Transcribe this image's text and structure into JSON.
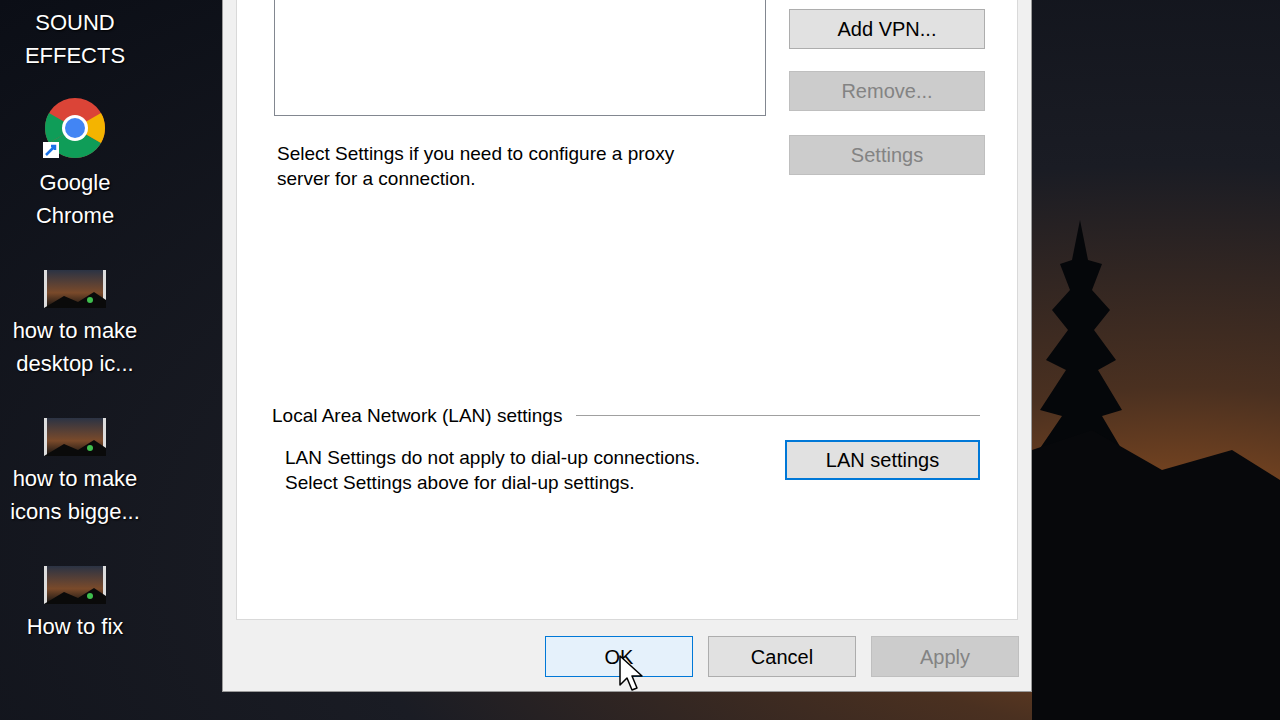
{
  "desktop_icons": [
    {
      "label": "SOUND EFFECTS",
      "kind": "folder"
    },
    {
      "label": "Google Chrome",
      "kind": "chrome"
    },
    {
      "label": "how to make desktop ic...",
      "kind": "video"
    },
    {
      "label": "how to make icons bigge...",
      "kind": "video"
    },
    {
      "label": "How to fix",
      "kind": "video"
    }
  ],
  "dialog": {
    "connection_buttons": [
      {
        "label": "Add VPN...",
        "disabled": false
      },
      {
        "label": "Remove...",
        "disabled": true
      },
      {
        "label": "Settings",
        "disabled": true
      }
    ],
    "proxy_hint_lines": [
      "Select Settings if you need to configure a proxy",
      "server for a connection."
    ],
    "lan": {
      "heading": "Local Area Network (LAN) settings",
      "hint_lines": [
        "LAN Settings do not apply to dial-up connections.",
        "Select Settings above for dial-up settings."
      ],
      "button": {
        "label": "LAN settings",
        "focused": true
      }
    },
    "footer_buttons": [
      {
        "label": "OK",
        "disabled": false,
        "hovered": true
      },
      {
        "label": "Cancel",
        "disabled": false,
        "hovered": false
      },
      {
        "label": "Apply",
        "disabled": true,
        "hovered": false
      }
    ]
  }
}
